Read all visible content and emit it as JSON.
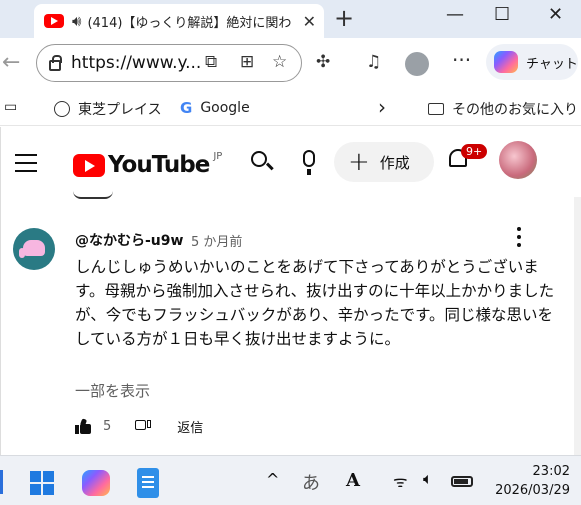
{
  "browser": {
    "tab_title": "(414)【ゆっくり解説】絶対に関わ",
    "tab_close": "✕",
    "new_tab": "+",
    "window_min": "—",
    "window_max": "☐",
    "window_close": "✕",
    "url": "https://www.y...",
    "copilot_label": "チャット",
    "menu_dots": "···",
    "back_arrow": "←"
  },
  "favorites": {
    "items": [
      "東芝プレイス",
      "Google"
    ],
    "other": "その他のお気に入り",
    "chevron": "›"
  },
  "youtube": {
    "logo_text": "YouTube",
    "region": "JP",
    "create_label": "作成",
    "create_plus": "+",
    "notification_badge": "9+"
  },
  "comment": {
    "author": "@なかむら-u9w",
    "time": "5 か月前",
    "text": "しんじしゅうめいかいのことをあげて下さってありがとうございます。母親から強制加入させられ、抜け出すのに十年以上かかりましたが、今でもフラッシュバックがあり、辛かったです。同じ様な思いをしている方が１日も早く抜け出せますように。",
    "show_more": "一部を表示",
    "like_count": "5",
    "reply_label": "返信"
  },
  "taskbar": {
    "chevron": "^",
    "ime": "あ",
    "ime2": "A",
    "wifi": "((·))",
    "volume": "🔈",
    "time": "23:02",
    "date": "2026/03/29"
  },
  "icons": {
    "search": "search-icon",
    "mic": "mic-icon",
    "bell": "bell-icon",
    "thumbs_up": "thumbs-up-icon",
    "thumbs_down": "thumbs-down-icon"
  }
}
